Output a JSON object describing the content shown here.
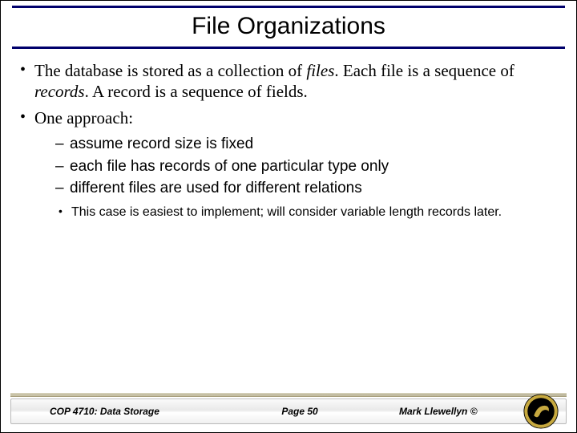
{
  "title": "File Organizations",
  "bullets": {
    "b1_part1": "The database is stored as a collection of ",
    "b1_italic1": "files",
    "b1_part2": ".  Each file is a sequence of ",
    "b1_italic2": "records",
    "b1_part3": ".  A record is a sequence of fields.",
    "b2": "One approach:",
    "s1": "assume record size is fixed",
    "s2": "each file has records of one particular type only",
    "s3": "different files are used for different relations",
    "ss1": "This case is easiest to implement; will consider variable length records later."
  },
  "footer": {
    "left": "COP 4710: Data Storage",
    "center": "Page 50",
    "right": "Mark Llewellyn ©"
  }
}
